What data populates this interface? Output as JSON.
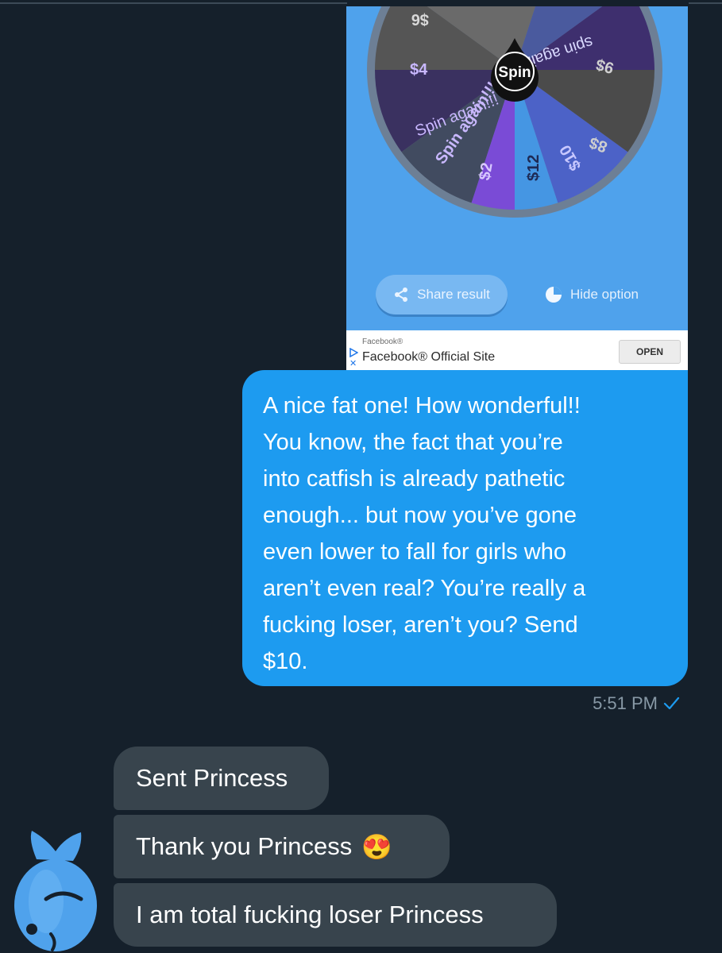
{
  "media": {
    "wheel_labels": [
      "$6",
      "spin again!!!",
      "$4",
      "9$",
      "8$",
      "$10",
      "$12",
      "$2",
      "Spin again!!!",
      "$4"
    ],
    "center_label": "Spin",
    "share_label": "Share result",
    "hide_label": "Hide option",
    "ad": {
      "small_label": "Facebook®",
      "title": "Facebook® Official Site",
      "button": "OPEN"
    }
  },
  "outgoing": {
    "text": "A nice fat one! How wonderful!!\nYou know, the fact that you’re\ninto catfish is already pathetic\nenough... but now you’ve gone\neven lower to fall for girls who\naren’t even real? You’re really a\nfucking loser, aren’t you? Send\n$10.",
    "time": "5:51 PM",
    "status_icon": "check-icon"
  },
  "incoming": [
    {
      "text": "Sent Princess"
    },
    {
      "text": "Thank you Princess",
      "emoji": "😍"
    },
    {
      "text": "I am total fucking loser Princess"
    }
  ],
  "avatar": {
    "icon": "fish-icon"
  },
  "colors": {
    "background": "#15202b",
    "outgoing_bubble": "#1d9bf0",
    "incoming_bubble": "#38444d",
    "media_bg": "#4fa2ec",
    "meta_text": "#8899a6"
  }
}
